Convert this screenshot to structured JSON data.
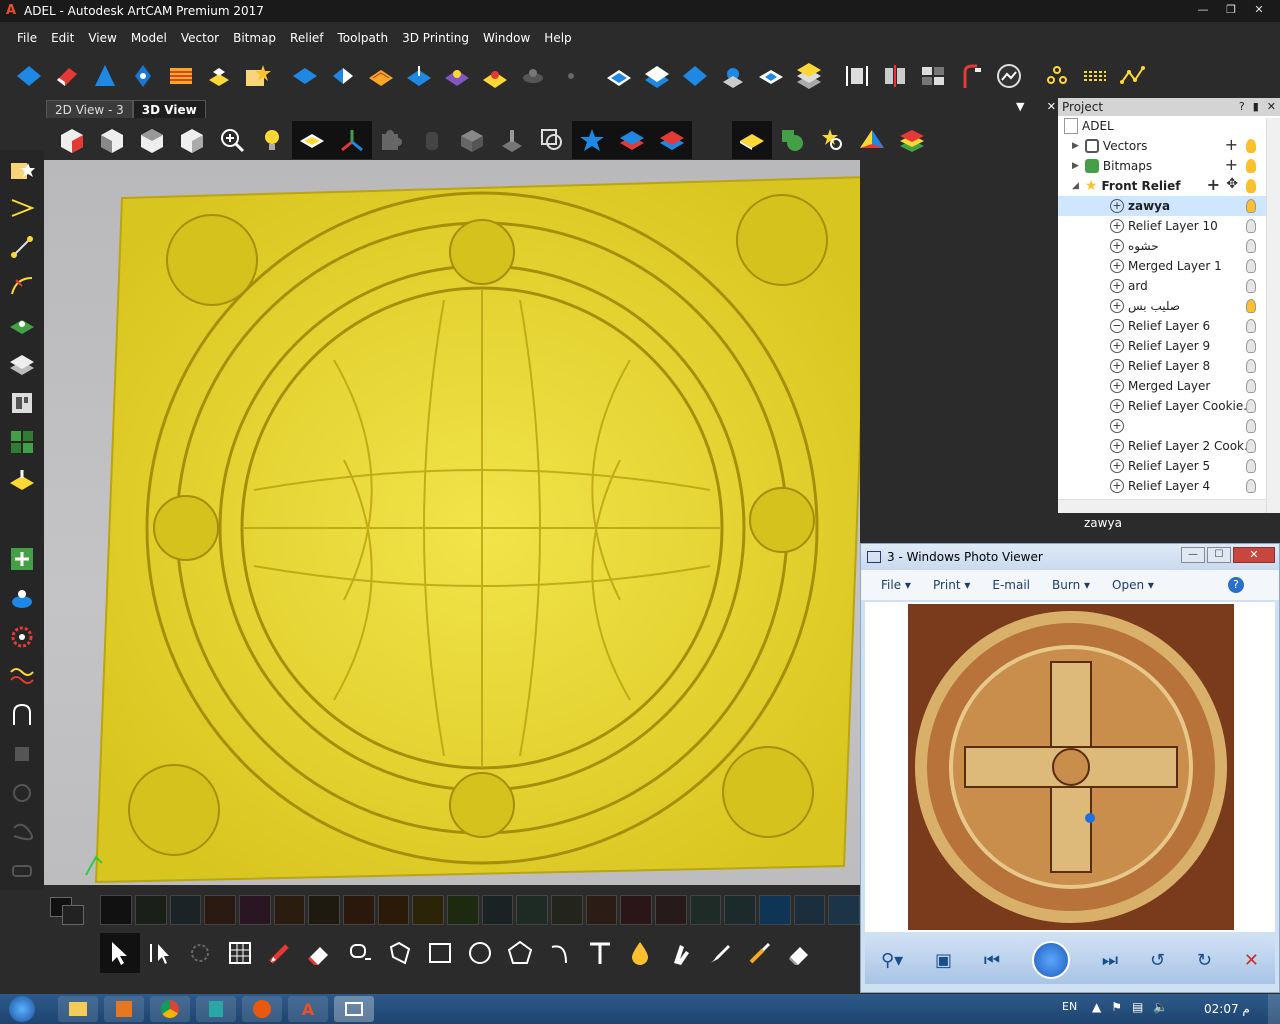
{
  "window": {
    "title": "ADEL - Autodesk ArtCAM Premium 2017",
    "app_icon": "A"
  },
  "menu": [
    "File",
    "Edit",
    "View",
    "Model",
    "Vector",
    "Bitmap",
    "Relief",
    "Toolpath",
    "3D Printing",
    "Window",
    "Help"
  ],
  "tabs": [
    "2D View - 3",
    "3D View"
  ],
  "project": {
    "header": "Project",
    "root": "ADEL",
    "groups": [
      "Vectors",
      "Bitmaps",
      "Front Relief"
    ],
    "layers": [
      {
        "name": "zawya",
        "selected": true,
        "lit": true
      },
      {
        "name": "Relief Layer 10",
        "selected": false,
        "lit": false
      },
      {
        "name": "حشوه",
        "selected": false,
        "lit": false
      },
      {
        "name": "Merged Layer 1",
        "selected": false,
        "lit": false
      },
      {
        "name": "ard",
        "selected": false,
        "lit": false
      },
      {
        "name": "صليب بس",
        "selected": false,
        "lit": true
      },
      {
        "name": "Relief Layer 6",
        "selected": false,
        "lit": false
      },
      {
        "name": "Relief Layer 9",
        "selected": false,
        "lit": false
      },
      {
        "name": "Relief Layer 8",
        "selected": false,
        "lit": false
      },
      {
        "name": "Merged Layer",
        "selected": false,
        "lit": false
      },
      {
        "name": "Relief Layer Cookie...",
        "selected": false,
        "lit": false
      },
      {
        "name": "",
        "selected": false,
        "lit": false
      },
      {
        "name": "Relief Layer 2 Cook...",
        "selected": false,
        "lit": false
      },
      {
        "name": "Relief Layer 5",
        "selected": false,
        "lit": false
      },
      {
        "name": "Relief Layer 4",
        "selected": false,
        "lit": false
      }
    ],
    "footer": "zawya"
  },
  "photo_viewer": {
    "title": "3 - Windows Photo Viewer",
    "menu": [
      "File",
      "Print",
      "E-mail",
      "Burn",
      "Open"
    ]
  },
  "taskbar": {
    "lang": "EN",
    "clock": "02:07 م"
  },
  "colors": {
    "relief": "#e8d531",
    "swatches": [
      "#111111",
      "#1a1f1a",
      "#1c2326",
      "#2a1a12",
      "#2a1622",
      "#2a1c0e",
      "#1f1a0f",
      "#2a180c",
      "#2c1a08",
      "#2c2408",
      "#1e2a10",
      "#1a2223",
      "#1e2a24",
      "#23251d",
      "#2b1c16",
      "#2a1619",
      "#261a1a",
      "#1f2b26",
      "#1d2a2b",
      "#0f3556",
      "#1a2e3d",
      "#1c3447"
    ]
  }
}
